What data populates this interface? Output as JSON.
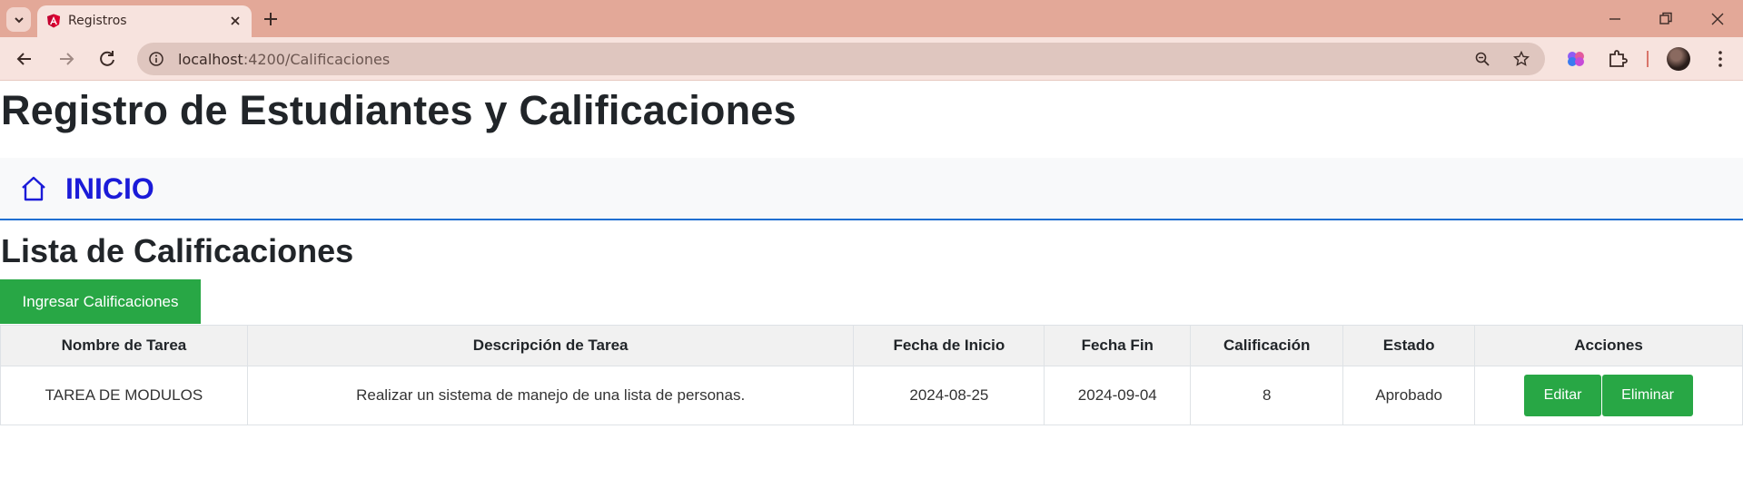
{
  "browser": {
    "tab_title": "Registros",
    "url_host": "localhost",
    "url_path": ":4200/Calificaciones"
  },
  "page": {
    "title": "Registro de Estudiantes y Calificaciones",
    "nav_link": "INICIO",
    "section_title": "Lista de Calificaciones",
    "add_button": "Ingresar Calificaciones"
  },
  "table": {
    "headers": [
      "Nombre de Tarea",
      "Descripción de Tarea",
      "Fecha de Inicio",
      "Fecha Fin",
      "Calificación",
      "Estado",
      "Acciones"
    ],
    "rows": [
      {
        "nombre": "TAREA DE MODULOS",
        "descripcion": "Realizar un sistema de manejo de una lista de personas.",
        "inicio": "2024-08-25",
        "fin": "2024-09-04",
        "calificacion": "8",
        "estado": "Aprobado",
        "edit_label": "Editar",
        "delete_label": "Eliminar"
      }
    ]
  },
  "colors": {
    "accent_green": "#28a745",
    "nav_link_blue": "#1b1bd8",
    "tabbar": "#e3a898"
  },
  "icons": [
    "tab-list-icon",
    "angular-favicon-icon",
    "close-icon",
    "plus-icon",
    "minimize-icon",
    "restore-icon",
    "window-close-icon",
    "back-icon",
    "forward-icon",
    "reload-icon",
    "site-info-icon",
    "zoom-icon",
    "star-icon",
    "extension-brain-icon",
    "puzzle-icon",
    "menu-dots-icon",
    "home-icon"
  ]
}
